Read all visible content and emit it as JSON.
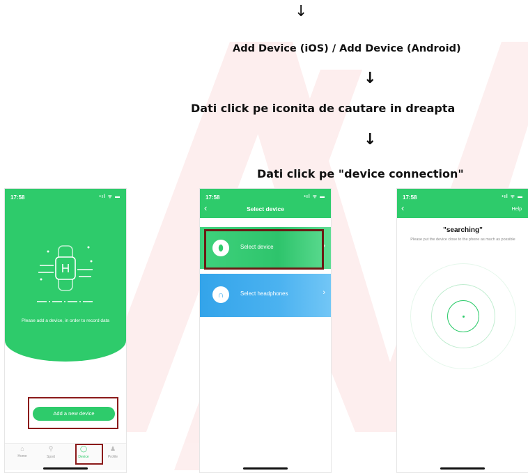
{
  "steps": {
    "arrow_top": "↓",
    "step1": "Add Device (iOS) / Add Device (Android)",
    "arrow1": "↓",
    "step2": "Dati click pe iconita de cautare in dreapta",
    "arrow2": "↓",
    "step3": "Dati click pe \"device connection\""
  },
  "phone1": {
    "time": "17:58",
    "status_icons": "•ıl ᯤ ▬",
    "message": "Please add a device, in order to record data",
    "add_button": "Add a new device",
    "tabs": [
      {
        "label": "Home",
        "icon": "home-icon"
      },
      {
        "label": "Sport",
        "icon": "sport-icon"
      },
      {
        "label": "Device",
        "icon": "device-icon"
      },
      {
        "label": "Profile",
        "icon": "profile-icon"
      }
    ]
  },
  "phone2": {
    "time": "17:58",
    "status_icons": "•ıl ᯤ ▬",
    "title": "Select device",
    "back": "‹",
    "options": [
      {
        "label": "Select device",
        "icon": "band-icon"
      },
      {
        "label": "Select headphones",
        "icon": "headphones-icon"
      }
    ]
  },
  "phone3": {
    "time": "17:58",
    "status_icons": "•ıl ᯤ ▬",
    "back": "‹",
    "help": "Help",
    "title": "\"searching\"",
    "description": "Please put the device close to the phone as much as possible"
  },
  "colors": {
    "green": "#2ecb6b",
    "blue": "#3aa9ee",
    "highlight": "#8b1a1a",
    "watermark": "#e81c1c"
  }
}
